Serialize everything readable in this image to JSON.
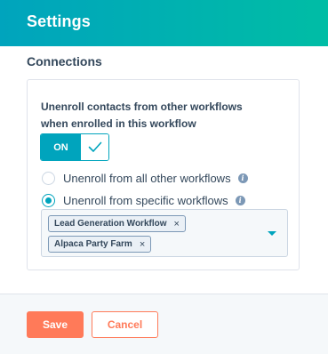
{
  "header": {
    "title": "Settings"
  },
  "section": {
    "title": "Connections"
  },
  "setting": {
    "description": "Unenroll contacts from other workflows when enrolled in this workflow",
    "toggle_label": "ON",
    "toggle_state": "on"
  },
  "options": [
    {
      "label": "Unenroll from all other workflows",
      "checked": false
    },
    {
      "label": "Unenroll from specific workflows",
      "checked": true
    }
  ],
  "selected_workflows": [
    {
      "label": "Lead Generation Workflow"
    },
    {
      "label": "Alpaca Party Farm"
    }
  ],
  "icons": {
    "remove": "×",
    "info": "i",
    "checkmark": "checkmark-icon",
    "caret": "caret-down-icon"
  },
  "footer": {
    "save_label": "Save",
    "cancel_label": "Cancel"
  },
  "colors": {
    "header_start": "#00a4bd",
    "header_end": "#00bda5",
    "accent": "#00a4bd",
    "primary_button": "#ff7a59",
    "text": "#33475b"
  }
}
